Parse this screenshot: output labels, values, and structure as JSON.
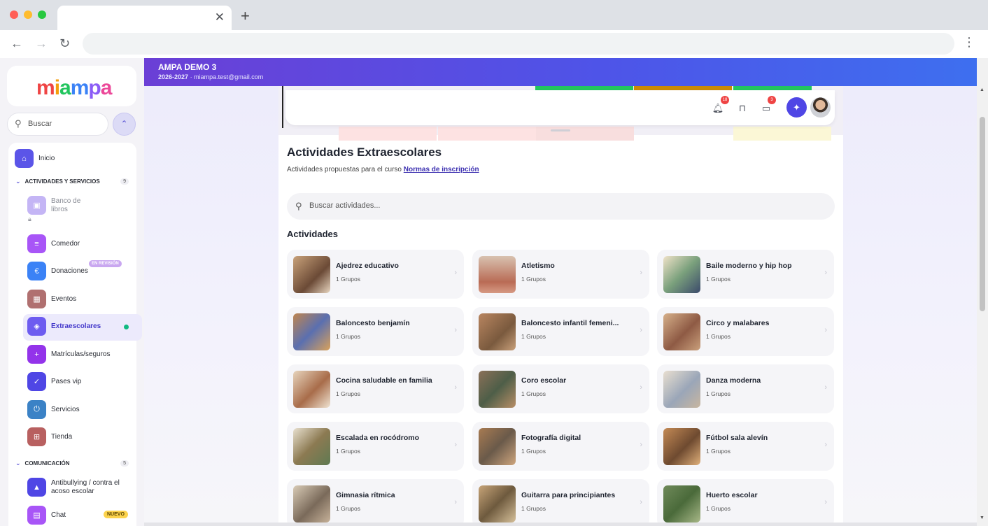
{
  "browser": {
    "new_tab_symbol": "+",
    "close_tab_symbol": "✕",
    "back_symbol": "←",
    "forward_symbol": "→",
    "reload_symbol": "↻",
    "menu_symbol": "⋮"
  },
  "header": {
    "org_name": "AMPA DEMO 3",
    "course": "2026-2027",
    "separator": "·",
    "email": "miampa.test@gmail.com"
  },
  "logo": {
    "text": "miampa"
  },
  "sidebar": {
    "search_placeholder": "Buscar",
    "home_label": "Inicio",
    "sections": [
      {
        "title": "ACTIVIDADES Y SERVICIOS",
        "count": "9"
      },
      {
        "title": "COMUNICACIÓN",
        "count": "5"
      }
    ],
    "items": [
      {
        "label": "Banco de libros",
        "badge": "EN REVISIÓN",
        "color": "#c4b5f5"
      },
      {
        "label": "Comedor",
        "color": "#a855f7"
      },
      {
        "label": "Donaciones",
        "color": "#3b82f6"
      },
      {
        "label": "Eventos",
        "color": "#a16565"
      },
      {
        "label": "Extraescolares",
        "color": "#6d5cf0"
      },
      {
        "label": "Matrículas/seguros",
        "color": "#9333ea"
      },
      {
        "label": "Pases vip",
        "color": "#4f46e5"
      },
      {
        "label": "Servicios",
        "color": "#3b82c6"
      },
      {
        "label": "Tienda",
        "color": "#b86060"
      },
      {
        "label": "Antibullying / contra el acoso escolar",
        "color": "#4f46e5"
      },
      {
        "label": "Chat",
        "badge": "NUEVO",
        "color": "#a855f7"
      }
    ]
  },
  "toolbar": {
    "notifications_count": "18",
    "cards_count": "3"
  },
  "main": {
    "title": "Actividades Extraescolares",
    "subtitle": "Actividades propuestas para el curso",
    "link": "Normas de inscripción",
    "search_placeholder": "Buscar actividades...",
    "section_title": "Actividades",
    "activities": [
      {
        "name": "Ajedrez educativo",
        "groups": "1 Grupos"
      },
      {
        "name": "Atletismo",
        "groups": "1 Grupos"
      },
      {
        "name": "Baile moderno y hip hop",
        "groups": "1 Grupos"
      },
      {
        "name": "Baloncesto benjamín",
        "groups": "1 Grupos"
      },
      {
        "name": "Baloncesto infantil femeni...",
        "groups": "1 Grupos"
      },
      {
        "name": "Circo y malabares",
        "groups": "1 Grupos"
      },
      {
        "name": "Cocina saludable en familia",
        "groups": "1 Grupos"
      },
      {
        "name": "Coro escolar",
        "groups": "1 Grupos"
      },
      {
        "name": "Danza moderna",
        "groups": "1 Grupos"
      },
      {
        "name": "Escalada en rocódromo",
        "groups": "1 Grupos"
      },
      {
        "name": "Fotografía digital",
        "groups": "1 Grupos"
      },
      {
        "name": "Fútbol sala alevín",
        "groups": "1 Grupos"
      },
      {
        "name": "Gimnasia rítmica",
        "groups": "1 Grupos"
      },
      {
        "name": "Guitarra para principiantes",
        "groups": "1 Grupos"
      },
      {
        "name": "Huerto escolar",
        "groups": "1 Grupos"
      }
    ]
  }
}
